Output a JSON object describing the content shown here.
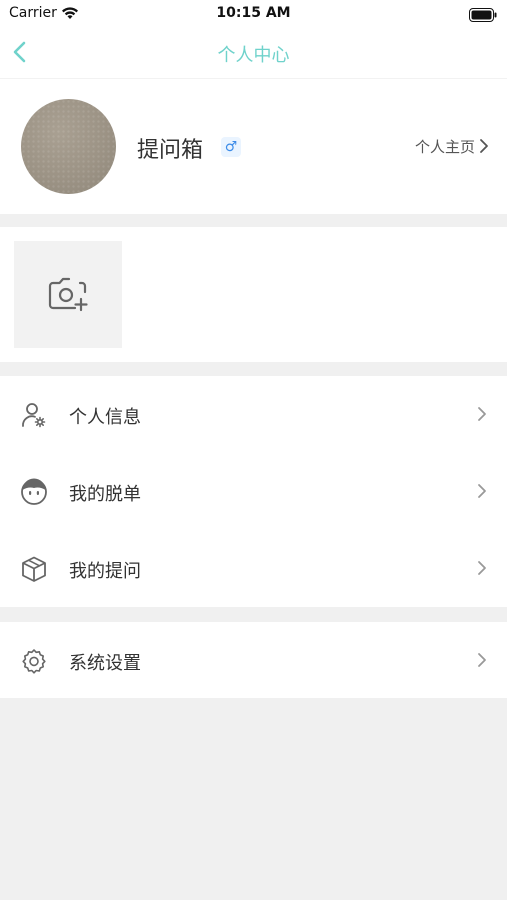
{
  "status_bar": {
    "carrier": "Carrier",
    "time": "10:15 AM"
  },
  "nav": {
    "title": "个人中心"
  },
  "profile": {
    "username": "提问箱",
    "gender_symbol": "♂",
    "homepage_link": "个人主页"
  },
  "menu": [
    {
      "label": "个人信息",
      "icon": "user-settings-icon"
    },
    {
      "label": "我的脱单",
      "icon": "face-icon"
    },
    {
      "label": "我的提问",
      "icon": "box-icon"
    }
  ],
  "settings": {
    "label": "系统设置",
    "icon": "gear-icon"
  },
  "colors": {
    "accent": "#6fd2cb",
    "gender_blue": "#3d8ce8",
    "background": "#f0f0f0"
  }
}
